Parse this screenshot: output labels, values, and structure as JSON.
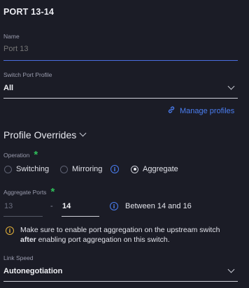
{
  "panel": {
    "title": "PORT 13-14"
  },
  "name_field": {
    "label": "Name",
    "placeholder": "Port 13"
  },
  "profile_field": {
    "label": "Switch Port Profile",
    "value": "All"
  },
  "manage_profiles": {
    "label": "Manage profiles"
  },
  "overrides": {
    "heading": "Profile Overrides"
  },
  "operation": {
    "label": "Operation",
    "required_mark": "*",
    "options": [
      "Switching",
      "Mirroring",
      "Aggregate"
    ],
    "selected": "Aggregate"
  },
  "aggregate_ports": {
    "label": "Aggregate Ports",
    "required_mark": "*",
    "from": "13",
    "separator": "-",
    "to": "14",
    "hint": "Between 14 and 16"
  },
  "warning": {
    "line1": "Make sure to enable port aggregation on the upstream switch",
    "line2_bold": "after",
    "line2_rest": " enabling port aggregation on this switch."
  },
  "link_speed": {
    "label": "Link Speed",
    "value": "Autonegotiation"
  },
  "colors": {
    "accent": "#4a7df0",
    "required": "#2fbf5a",
    "warning": "#e2b03a",
    "background": "#1b1c26"
  }
}
